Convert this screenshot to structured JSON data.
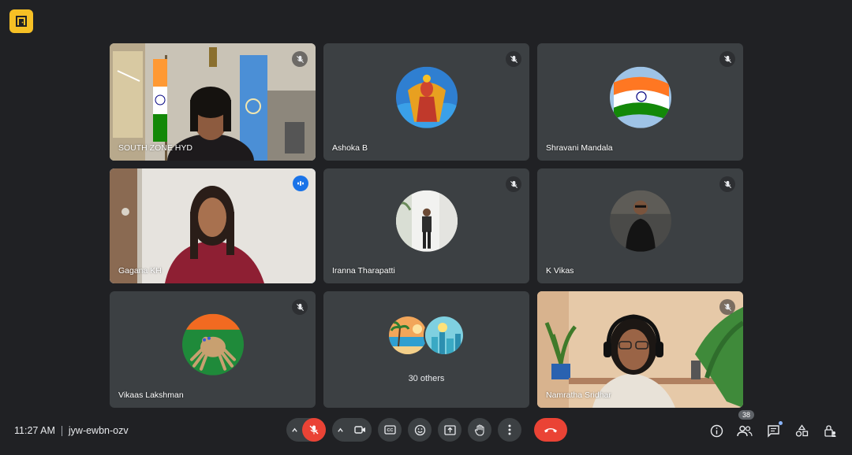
{
  "app": {
    "logo_icon": "door-exit-icon",
    "logo_color": "#f6c025"
  },
  "tiles": [
    {
      "name": "SOUTH ZONE HYD",
      "status": "muted",
      "media": "camera"
    },
    {
      "name": "Ashoka B",
      "status": "muted",
      "media": "avatar"
    },
    {
      "name": "Shravani Mandala",
      "status": "muted",
      "media": "avatar"
    },
    {
      "name": "Gagana KH",
      "status": "speaking",
      "media": "camera"
    },
    {
      "name": "Iranna Tharapatti",
      "status": "muted",
      "media": "avatar"
    },
    {
      "name": "K Vikas",
      "status": "muted",
      "media": "avatar"
    },
    {
      "name": "Vikaas Lakshman",
      "status": "muted",
      "media": "avatar"
    },
    {
      "name": "30 others",
      "status": "",
      "media": "others"
    },
    {
      "name": "Namratha Sridhar",
      "status": "muted",
      "media": "camera"
    }
  ],
  "bottom_bar": {
    "time": "11:27 AM",
    "meeting_code": "jyw-ewbn-ozv",
    "participants_count": "38",
    "controls": [
      "mic-off",
      "camera",
      "captions",
      "emoji",
      "present",
      "raise-hand",
      "more",
      "end-call"
    ],
    "right_tools": [
      "info",
      "people",
      "chat",
      "activities",
      "host-controls"
    ]
  },
  "colors": {
    "accent": "#8ab4f8",
    "danger": "#ea4335",
    "tile_bg": "#3c4043",
    "page_bg": "#202124"
  }
}
